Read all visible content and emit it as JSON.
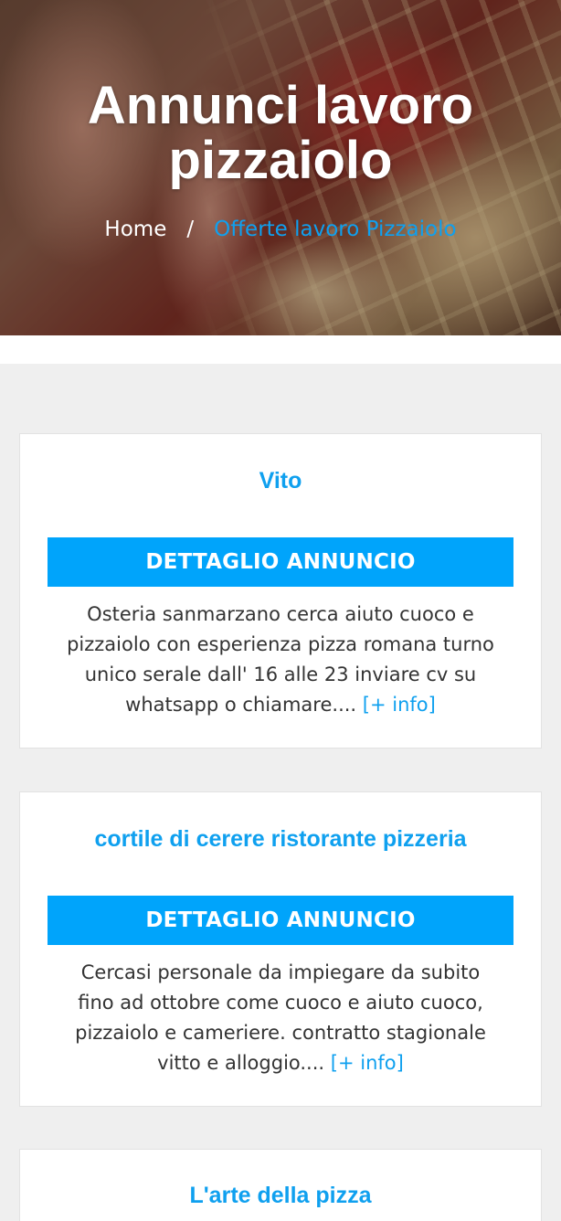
{
  "hero": {
    "title_line1": "Annunci lavoro",
    "title_line2": "pizzaiolo",
    "breadcrumb": {
      "home": "Home",
      "separator": "/",
      "current": "Offerte lavoro Pizzaiolo"
    }
  },
  "listings": [
    {
      "title": "Vito",
      "button": "DETTAGLIO ANNUNCIO",
      "description_lines": [
        "Osteria sanmarzano cerca aiuto cuoco e",
        "pizzaiolo con esperienza pizza romana turno",
        "unico serale dall' 16 alle 23 inviare cv su",
        "whatsapp o chiamare...."
      ],
      "more": "[+ info]"
    },
    {
      "title": "cortile di cerere ristorante pizzeria",
      "button": "DETTAGLIO ANNUNCIO",
      "description_lines": [
        "Cercasi personale da impiegare da subito",
        "fino ad ottobre come cuoco e aiuto cuoco,",
        "pizzaiolo e cameriere. contratto stagionale",
        "vitto e alloggio...."
      ],
      "more": "[+ info]"
    },
    {
      "title": "L'arte della pizza"
    }
  ],
  "colors": {
    "accent": "#0fa0ef",
    "button": "#00a4fb",
    "page_bg": "#efefef"
  }
}
